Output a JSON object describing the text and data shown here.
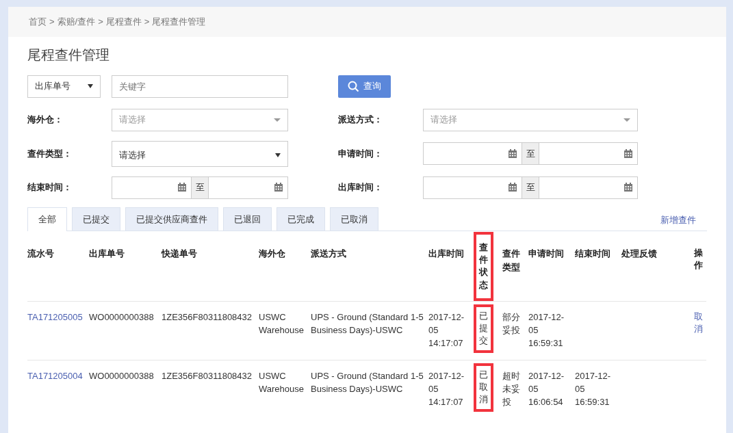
{
  "breadcrumb": {
    "items": [
      "首页",
      "索赔/查件",
      "尾程查件",
      "尾程查件管理"
    ],
    "separator": ">"
  },
  "title": "尾程查件管理",
  "search": {
    "field": "出库单号",
    "placeholder": "关键字",
    "button": "查询"
  },
  "filters": [
    {
      "label": "海外仓：",
      "kind": "select",
      "placeholder": "请选择"
    },
    {
      "label": "派送方式：",
      "kind": "select",
      "placeholder": "请选择"
    },
    {
      "label": "查件类型：",
      "kind": "native-select",
      "value": "请选择"
    },
    {
      "label": "申请时间：",
      "kind": "date-range",
      "separator": "至"
    },
    {
      "label": "结束时间：",
      "kind": "date-range",
      "separator": "至"
    },
    {
      "label": "出库时间：",
      "kind": "date-range",
      "separator": "至"
    }
  ],
  "tabs": [
    {
      "label": "全部",
      "selected": true
    },
    {
      "label": "已提交",
      "selected": false
    },
    {
      "label": "已提交供应商查件",
      "selected": false
    },
    {
      "label": "已退回",
      "selected": false
    },
    {
      "label": "已完成",
      "selected": false
    },
    {
      "label": "已取消",
      "selected": false
    }
  ],
  "new_link": "新增查件",
  "table": {
    "columns": [
      {
        "label": "流水号",
        "highlighted": false
      },
      {
        "label": "出库单号",
        "highlighted": false
      },
      {
        "label": "快递单号",
        "highlighted": false
      },
      {
        "label": "海外仓",
        "highlighted": false
      },
      {
        "label": "派送方式",
        "highlighted": false
      },
      {
        "label": "出库时间",
        "highlighted": false
      },
      {
        "label": "查件状态",
        "highlighted": true
      },
      {
        "label": "查件类型",
        "highlighted": false
      },
      {
        "label": "申请时间",
        "highlighted": false
      },
      {
        "label": "结束时间",
        "highlighted": false
      },
      {
        "label": "处理反馈",
        "highlighted": false
      },
      {
        "label": "操作",
        "highlighted": false
      }
    ],
    "rows": [
      {
        "serial": "TA171205005",
        "order": "WO0000000388",
        "tracking": "1ZE356F80311808432",
        "warehouse": "USWC Warehouse",
        "delivery": "UPS - Ground (Standard 1-5 Business Days)-USWC",
        "out_time": "2017-12-05 14:17:07",
        "status": "已提交",
        "status_highlighted": true,
        "type": "部分妥投",
        "apply_time": "2017-12-05 16:59:31",
        "action": "取消"
      },
      {
        "serial": "TA171205004",
        "order": "WO0000000388",
        "tracking": "1ZE356F80311808432",
        "warehouse": "USWC Warehouse",
        "delivery": "UPS - Ground (Standard 1-5 Business Days)-USWC",
        "out_time": "2017-12-05 14:17:07",
        "status": "已取消",
        "status_highlighted": true,
        "type": "超时未妥投",
        "apply_time": "2017-12-05 16:06:54",
        "end_time": "2017-12-05 16:59:31"
      }
    ]
  }
}
